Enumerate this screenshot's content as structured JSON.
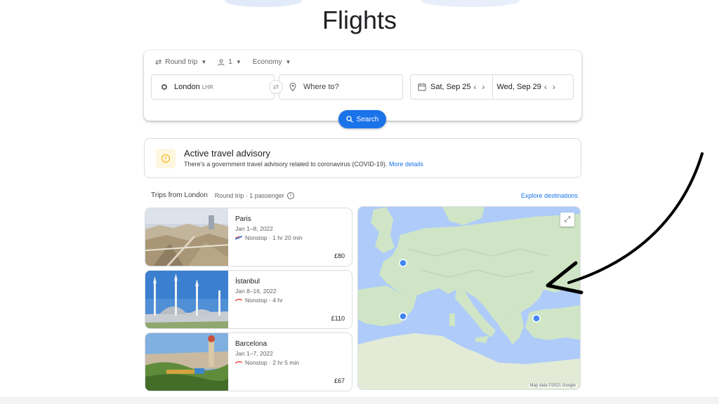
{
  "page": {
    "title": "Flights"
  },
  "search": {
    "trip_type": "Round trip",
    "passengers": "1",
    "cabin": "Economy",
    "from_city": "London",
    "from_code": "LHR",
    "to_placeholder": "Where to?",
    "depart_date": "Sat, Sep 25",
    "return_date": "Wed, Sep 29",
    "search_label": "Search"
  },
  "advisory": {
    "title": "Active travel advisory",
    "text": "There's a government travel advisory related to coronavirus (COVID-19).",
    "link": "More details"
  },
  "trips": {
    "heading": "Trips from London",
    "subheading": "Round trip · 1 passenger",
    "explore_link": "Explore destinations",
    "items": [
      {
        "name": "Paris",
        "dates": "Jan 1–8, 2022",
        "flight": "Nonstop · 1 hr 20 min",
        "price": "£80"
      },
      {
        "name": "İstanbul",
        "dates": "Jan 8–16, 2022",
        "flight": "Nonstop · 4 hr",
        "price": "£110"
      },
      {
        "name": "Barcelona",
        "dates": "Jan 1–7, 2022",
        "flight": "Nonstop · 2 hr 5 min",
        "price": "£67"
      }
    ]
  },
  "map": {
    "credit": "Map data ©2021 Google"
  },
  "colors": {
    "accent": "#1a73e8",
    "water": "#aecbfa",
    "land": "#cfe5c6",
    "advisory": "#f9ab00"
  },
  "icons": [
    "swap-icon",
    "person-icon",
    "location-pin-icon",
    "calendar-icon",
    "search-icon",
    "warning-icon",
    "info-icon",
    "expand-icon"
  ]
}
